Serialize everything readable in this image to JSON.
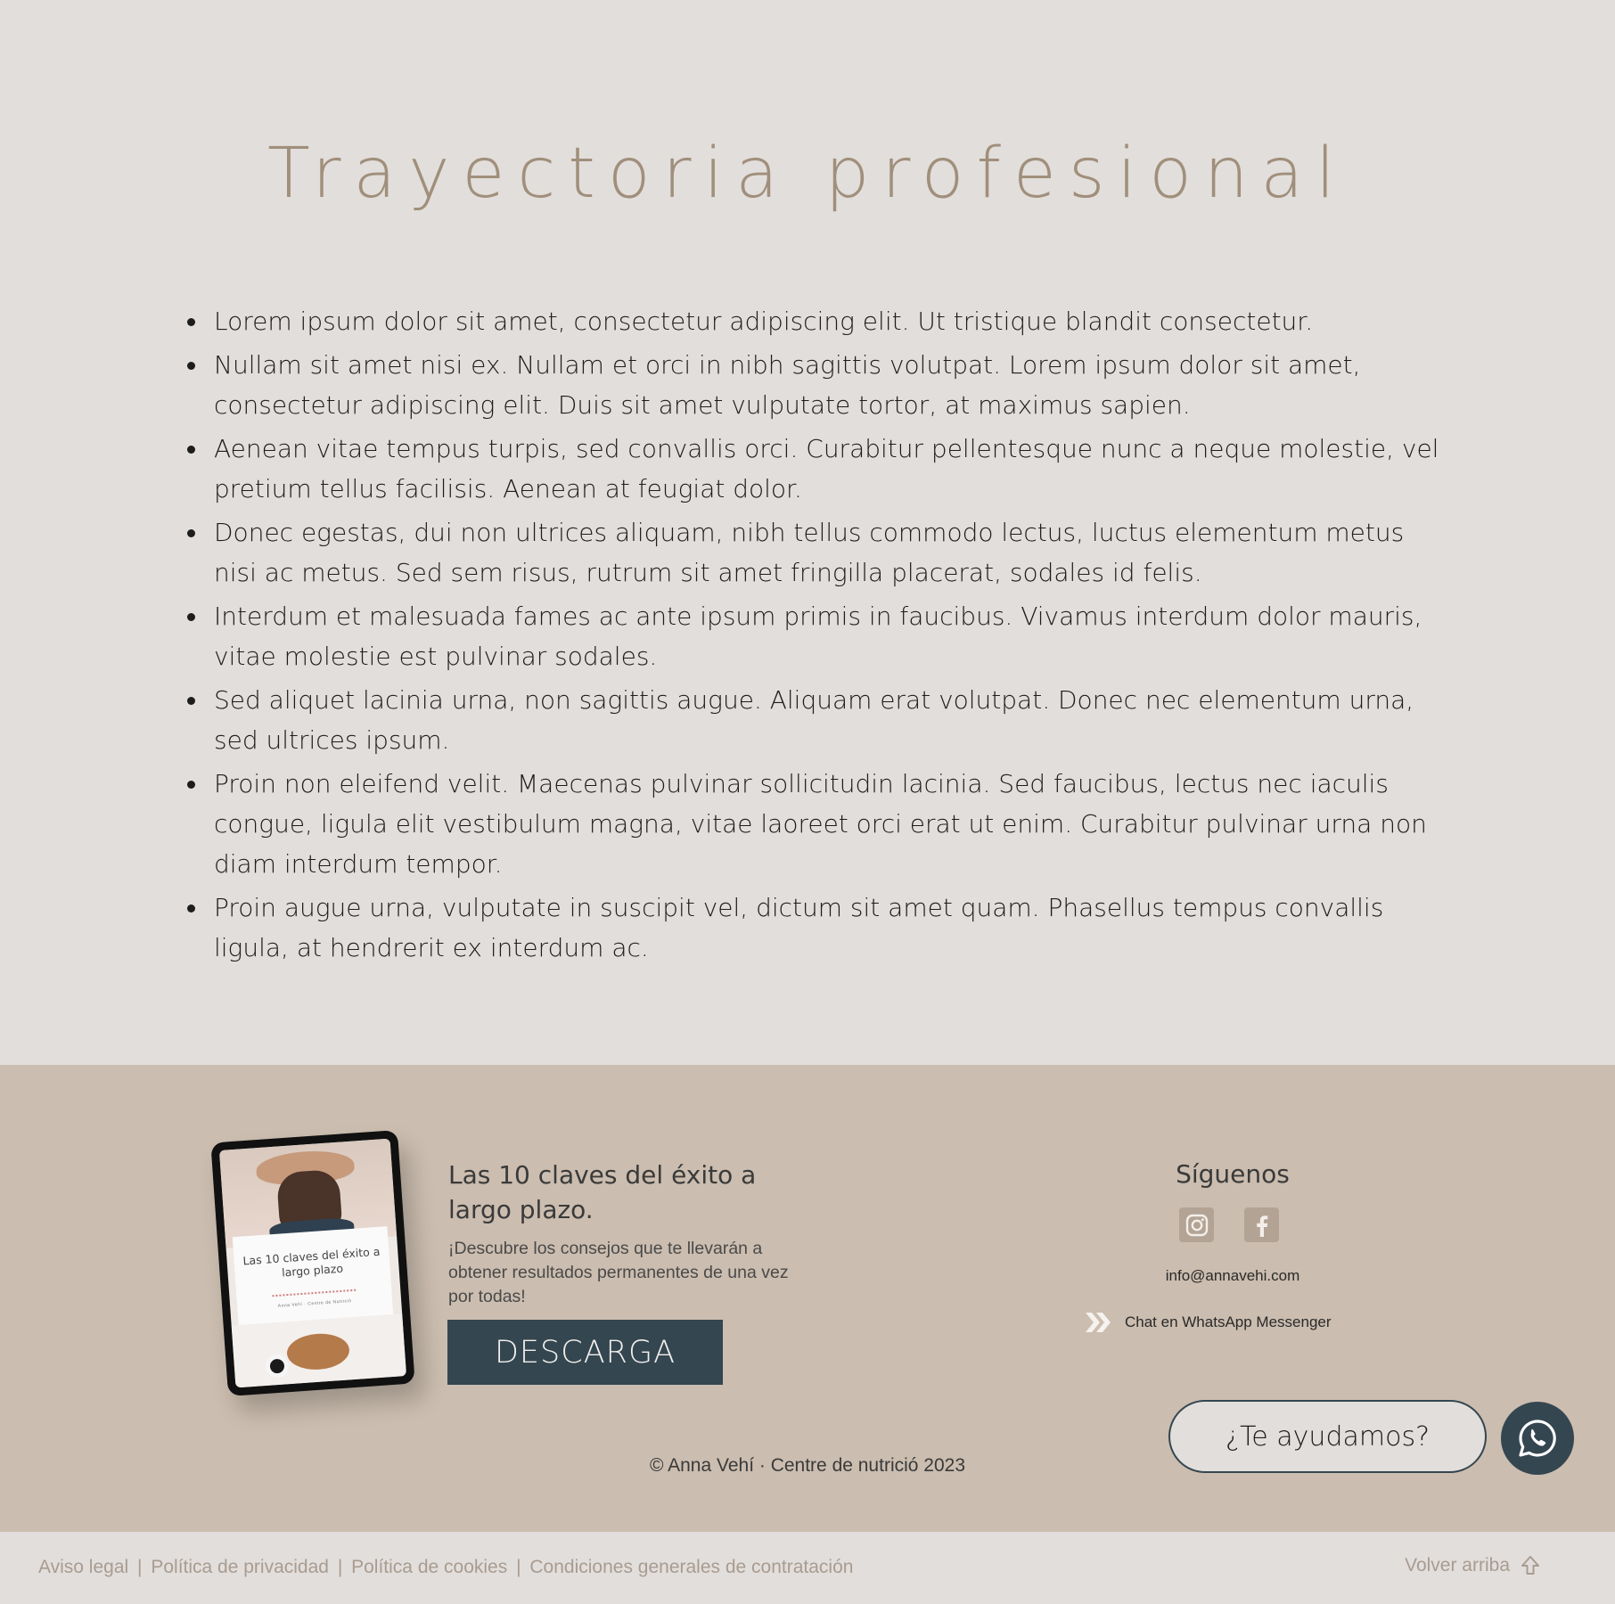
{
  "main": {
    "title": "Trayectoria profesional",
    "bullets": [
      "Lorem ipsum dolor sit amet, consectetur adipiscing elit. Ut tristique blandit consectetur.",
      "Nullam sit amet nisi ex. Nullam et orci in nibh sagittis volutpat. Lorem ipsum dolor sit amet, consectetur adipiscing elit. Duis sit amet vulputate tortor, at maximus sapien.",
      "Aenean vitae tempus turpis, sed convallis orci. Curabitur pellentesque nunc a neque molestie, vel pretium tellus facilisis. Aenean at feugiat dolor.",
      "Donec egestas, dui non ultrices aliquam, nibh tellus commodo lectus, luctus elementum metus nisi ac metus. Sed sem risus, rutrum sit amet fringilla placerat, sodales id felis.",
      "Interdum et malesuada fames ac ante ipsum primis in faucibus. Vivamus interdum dolor mauris, vitae molestie est pulvinar sodales.",
      "Sed aliquet lacinia urna, non sagittis augue. Aliquam erat volutpat. Donec nec elementum urna, sed ultrices ipsum.",
      "Proin non eleifend velit. Maecenas pulvinar sollicitudin lacinia. Sed faucibus, lectus nec iaculis congue, ligula elit vestibulum magna, vitae laoreet orci erat ut enim. Curabitur pulvinar urna non diam interdum tempor.",
      "Proin augue urna, vulputate in suscipit vel, dictum sit amet quam. Phasellus tempus convallis ligula, at hendrerit ex interdum ac."
    ]
  },
  "footer": {
    "ebook_cover": {
      "title": "Las 10 claves del éxito a largo plazo",
      "subtitle": "Anna Vehí · Centre de Nutrició"
    },
    "promo": {
      "title": "Las 10 claves del éxito a largo plazo.",
      "description": "¡Descubre los consejos que te llevarán a obtener resultados permanentes de una vez por todas!",
      "button_label": "DESCARGA"
    },
    "social": {
      "title": "Síguenos",
      "icons": [
        "instagram-icon",
        "facebook-icon"
      ],
      "email": "info@annavehi.com",
      "whatsapp_label": "Chat en WhatsApp Messenger"
    },
    "help_label": "¿Te ayudamos?",
    "copyright": "© Anna Vehí · Centre de nutrició 2023"
  },
  "bottom_bar": {
    "links": [
      "Aviso legal",
      "Política de privacidad",
      "Política de cookies",
      "Condiciones generales de contratación"
    ],
    "separator": "|",
    "back_to_top": "Volver arriba"
  },
  "colors": {
    "background": "#e2dedb",
    "footer_bg": "#cbbdaf",
    "title_accent": "#a08f7b",
    "dark_accent": "#344650",
    "muted_link": "#a89c91"
  }
}
